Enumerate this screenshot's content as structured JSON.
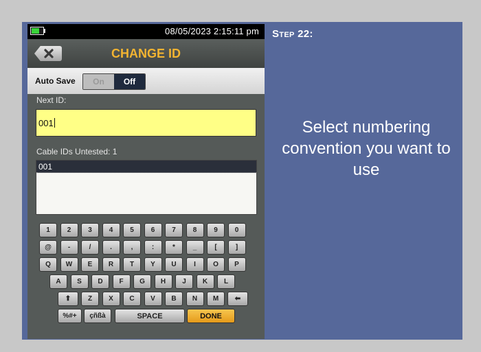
{
  "device": {
    "status": {
      "datetime": "08/05/2023 2:15:11 pm",
      "battery_level": 0.7
    },
    "title": "CHANGE ID",
    "auto_save": {
      "label": "Auto Save",
      "on": "On",
      "off": "Off",
      "selected": "Off"
    },
    "next_id": {
      "label": "Next ID:",
      "value": "001"
    },
    "untested": {
      "label": "Cable IDs Untested: 1",
      "items": [
        "001"
      ]
    },
    "keyboard": {
      "rows": [
        [
          "1",
          "2",
          "3",
          "4",
          "5",
          "6",
          "7",
          "8",
          "9",
          "0"
        ],
        [
          "@",
          "-",
          "/",
          ".",
          ",",
          ":",
          "*",
          "_",
          "[",
          "]"
        ],
        [
          "Q",
          "W",
          "E",
          "R",
          "T",
          "Y",
          "U",
          "I",
          "O",
          "P"
        ],
        [
          "A",
          "S",
          "D",
          "F",
          "G",
          "H",
          "J",
          "K",
          "L"
        ],
        [
          "Z",
          "X",
          "C",
          "V",
          "B",
          "N",
          "M"
        ]
      ],
      "shift": "⬆",
      "backspace": "⬅",
      "symbols": "%#+",
      "accents": "çñßà",
      "space": "SPACE",
      "done": "DONE"
    }
  },
  "instructions": {
    "step": "Step 22:",
    "text": "Select numbering convention you want to use"
  },
  "colors": {
    "panel": "#56689a",
    "title_accent": "#f3b431",
    "input_bg": "#ffff86",
    "done_key": "#f3b431"
  }
}
